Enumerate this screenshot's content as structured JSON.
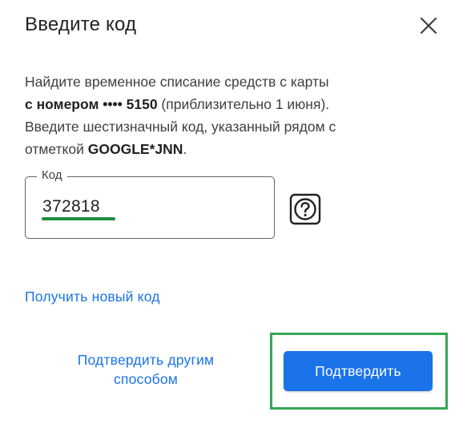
{
  "dialog": {
    "title": "Введите код",
    "close_icon": "close-icon"
  },
  "description": {
    "line1": "Найдите временное списание средств с карты",
    "line2_bold": "с номером •••• 5150",
    "line2_rest": " (приблизительно 1 июня).",
    "line3": "Введите шестизначный код, указанный рядом с",
    "line4_prefix": "отметкой ",
    "line4_bold": "GOOGLE*JNN",
    "line4_suffix": "."
  },
  "code_field": {
    "label": "Код",
    "value": "372818"
  },
  "help": {
    "icon": "help-question-icon"
  },
  "links": {
    "new_code": "Получить новый код",
    "alt_method_line1": "Подтвердить другим",
    "alt_method_line2": "способом"
  },
  "actions": {
    "confirm": "Подтвердить"
  },
  "colors": {
    "accent": "#1a73e8",
    "highlight": "#34a853",
    "underline": "#1e8e3e",
    "text": "#202124"
  }
}
